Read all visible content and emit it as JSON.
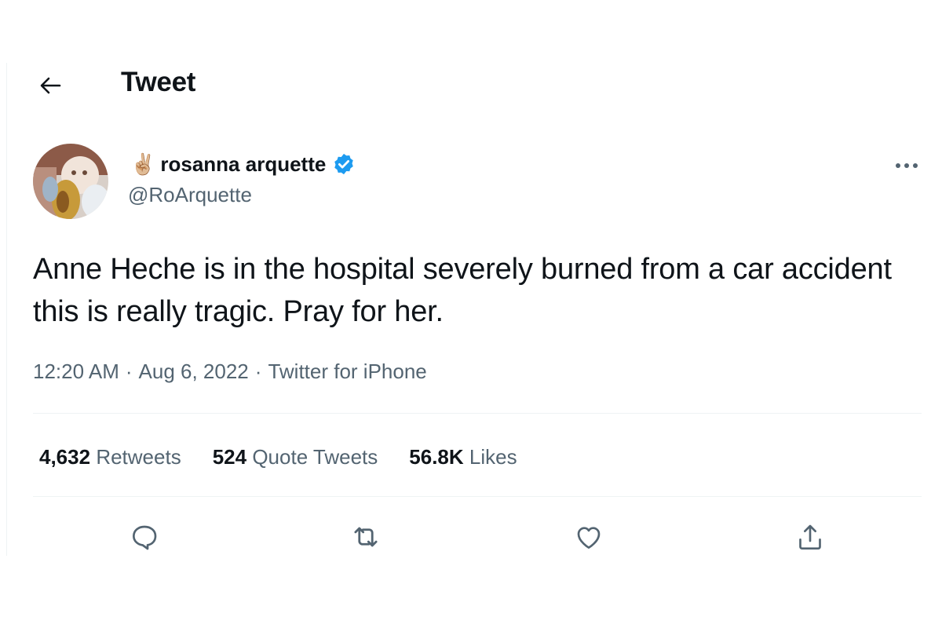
{
  "header": {
    "title": "Tweet",
    "back_icon": "arrow-left-icon"
  },
  "author": {
    "emoji": "✌🏼",
    "display_name": "rosanna arquette",
    "handle": "@RoArquette",
    "verified": true,
    "verified_color": "#1d9bf0"
  },
  "tweet": {
    "text": "Anne Heche is in the hospital severely burned from a car accident this is really tragic. Pray for her.",
    "time": "12:20 AM",
    "date": "Aug 6, 2022",
    "source": "Twitter for iPhone",
    "separator": "·"
  },
  "stats": {
    "retweets_count": "4,632",
    "retweets_label": "Retweets",
    "quotes_count": "524",
    "quotes_label": "Quote Tweets",
    "likes_count": "56.8K",
    "likes_label": "Likes"
  },
  "actions": [
    "reply-icon",
    "retweet-icon",
    "like-icon",
    "share-icon"
  ],
  "colors": {
    "text": "#0f1419",
    "secondary": "#536471",
    "divider": "#eff3f4",
    "accent": "#1d9bf0"
  }
}
